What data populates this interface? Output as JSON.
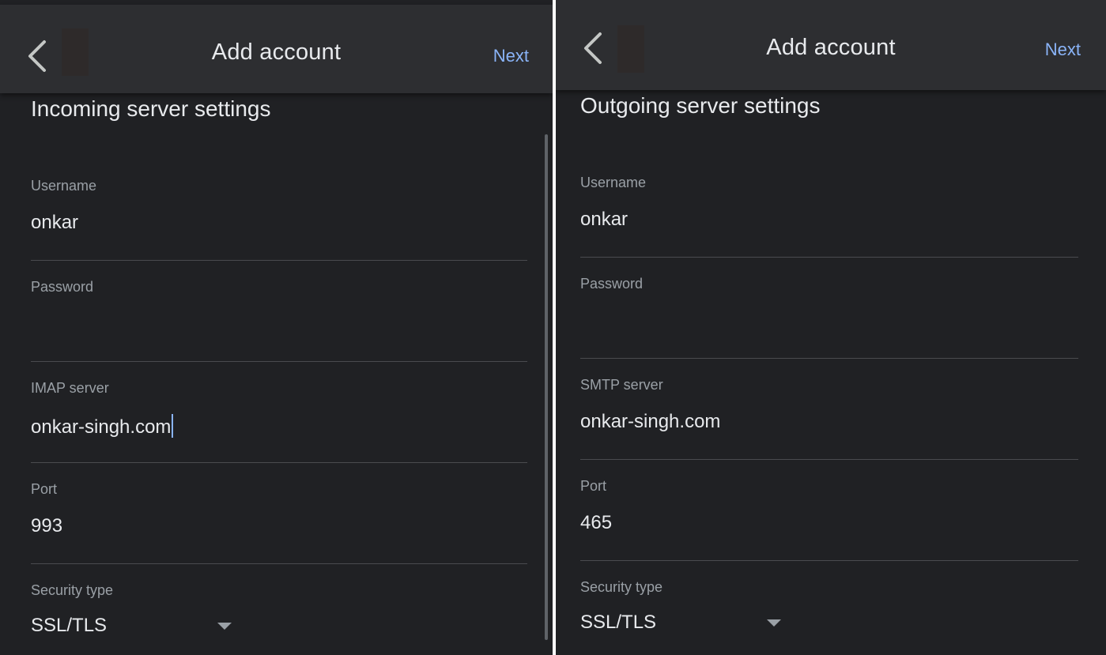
{
  "left_panel": {
    "appbar": {
      "title": "Add account",
      "next_label": "Next"
    },
    "heading": "Incoming server settings",
    "fields": {
      "username": {
        "label": "Username",
        "value": "onkar"
      },
      "password": {
        "label": "Password",
        "value": ""
      },
      "server": {
        "label": "IMAP server",
        "value": "onkar-singh.com"
      },
      "port": {
        "label": "Port",
        "value": "993"
      },
      "security": {
        "label": "Security type",
        "value": "SSL/TLS"
      }
    }
  },
  "right_panel": {
    "appbar": {
      "title": "Add account",
      "next_label": "Next"
    },
    "heading": "Outgoing server settings",
    "fields": {
      "username": {
        "label": "Username",
        "value": "onkar"
      },
      "password": {
        "label": "Password",
        "value": ""
      },
      "server": {
        "label": "SMTP server",
        "value": "onkar-singh.com"
      },
      "port": {
        "label": "Port",
        "value": "465"
      },
      "security": {
        "label": "Security type",
        "value": "SSL/TLS"
      }
    }
  },
  "icons": {
    "back": "chevron-left-icon",
    "dropdown": "caret-down-icon"
  },
  "colors": {
    "background": "#202124",
    "appbar": "#2d2e31",
    "accent": "#8ab4f8",
    "text_primary": "#e8eaed",
    "text_secondary": "#9aa0a6",
    "divider": "#4a4b4f"
  }
}
